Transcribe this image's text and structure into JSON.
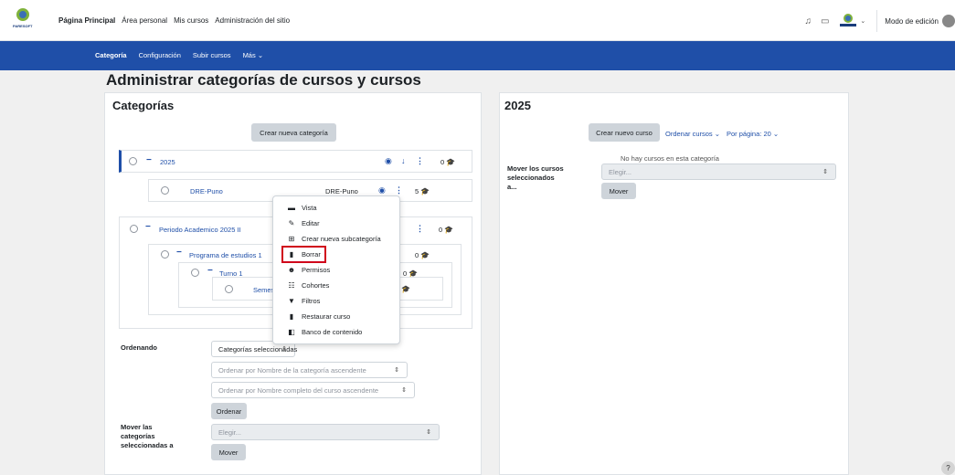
{
  "brand": {
    "logo_text": "PARESOFT"
  },
  "topnav": {
    "items": [
      "Página Principal",
      "Área personal",
      "Mis cursos",
      "Administración del sitio"
    ]
  },
  "topright": {
    "edit_mode_label": "Modo de edición"
  },
  "secondary_nav": {
    "items": [
      "Categoría",
      "Configuración",
      "Subir cursos",
      "Más ⌄"
    ]
  },
  "page_title": "Administrar categorías de cursos y cursos",
  "left_panel": {
    "title": "Categorías",
    "create_button": "Crear nueva categoría",
    "tree": [
      {
        "name": "2025",
        "count": "0"
      },
      {
        "name": "DRE-Puno",
        "idnumber": "DRE-Puno",
        "count": "5"
      },
      {
        "name": "Periodo Academico 2025 II",
        "count": "0"
      },
      {
        "name": "Programa de estudios 1",
        "count": "0"
      },
      {
        "name": "Turno 1",
        "count": "0"
      },
      {
        "name": "Semes"
      }
    ],
    "sorting": {
      "label": "Ordenando",
      "select_scope": "Categorías seleccionadas",
      "select_category": "Ordenar por Nombre de la categoría ascendente",
      "select_course": "Ordenar por Nombre completo del curso ascendente",
      "button": "Ordenar"
    },
    "move": {
      "label_line1": "Mover las",
      "label_line2": "categorías",
      "label_line3": "seleccionadas a",
      "placeholder": "Elegir...",
      "button": "Mover"
    }
  },
  "right_panel": {
    "title": "2025",
    "create_course_button": "Crear nuevo curso",
    "sort_courses": "Ordenar cursos ⌄",
    "per_page": "Por página: 20 ⌄",
    "empty_message": "No hay cursos en esta categoría",
    "move_label_line1": "Mover los cursos",
    "move_label_line2": "seleccionados",
    "move_label_line3": "a...",
    "move_placeholder": "Elegir...",
    "move_button": "Mover"
  },
  "context_menu": {
    "items": [
      {
        "label": "Vista",
        "icon": "monitor-icon"
      },
      {
        "label": "Editar",
        "icon": "pencil-icon"
      },
      {
        "label": "Crear nueva subcategoría",
        "icon": "sitemap-icon"
      },
      {
        "label": "Borrar",
        "icon": "trash-icon"
      },
      {
        "label": "Permisos",
        "icon": "users-icon"
      },
      {
        "label": "Cohortes",
        "icon": "cohort-icon"
      },
      {
        "label": "Filtros",
        "icon": "filter-icon"
      },
      {
        "label": "Restaurar curso",
        "icon": "trash-restore-icon"
      },
      {
        "label": "Banco de contenido",
        "icon": "content-bank-icon"
      }
    ]
  },
  "colors": {
    "primary": "#1f4fa8",
    "highlight": "#d0021b"
  },
  "help_label": "?"
}
